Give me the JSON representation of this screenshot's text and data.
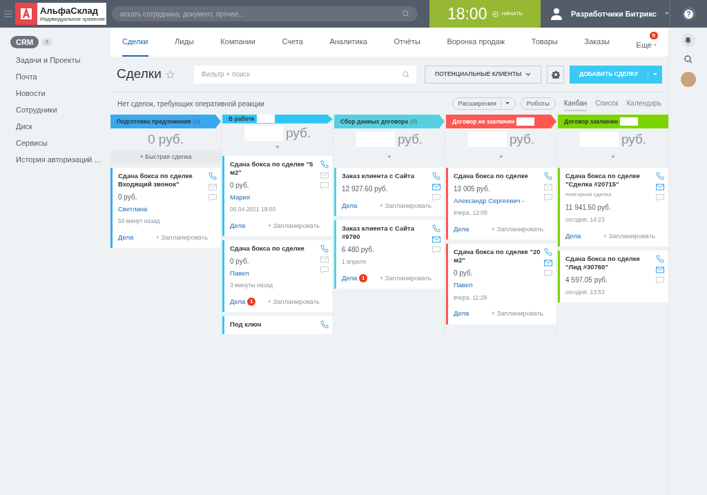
{
  "header": {
    "logo_title": "АльфаСклад",
    "logo_subtitle": "Индивидуальное хранение",
    "search_placeholder": "искать сотрудника, документ, прочее...",
    "clock": "18:00",
    "start": "НАЧАТЬ",
    "user": "Разработчики Битрикс",
    "help": "?"
  },
  "sidebar": {
    "items": [
      {
        "label": "CRM",
        "selected": true,
        "count": "5"
      },
      {
        "label": "Задачи и Проекты",
        "selected": false
      },
      {
        "label": "Почта",
        "selected": false
      },
      {
        "label": "Новости",
        "selected": false
      },
      {
        "label": "Сотрудники",
        "selected": false
      },
      {
        "label": "Диск",
        "selected": false
      },
      {
        "label": "Сервисы",
        "selected": false
      },
      {
        "label": "История авторизаций ...",
        "selected": false
      }
    ]
  },
  "tabs": [
    {
      "label": "Сделки",
      "selected": true
    },
    {
      "label": "Лиды",
      "selected": false
    },
    {
      "label": "Компании",
      "selected": false
    },
    {
      "label": "Счета",
      "selected": false
    },
    {
      "label": "Аналитика",
      "selected": false
    },
    {
      "label": "Отчёты",
      "selected": false
    },
    {
      "label": "Воронка продаж",
      "selected": false
    },
    {
      "label": "Товары",
      "selected": false
    },
    {
      "label": "Заказы",
      "selected": false
    },
    {
      "label": "Еще",
      "selected": false,
      "count": "5"
    }
  ],
  "toolbar": {
    "title": "Сделки",
    "filter_placeholder": "Фильтр + поиск",
    "category": "ПОТЕНЦИАЛЬНЫЕ КЛИЕНТЫ",
    "add": "ДОБАВИТЬ СДЕЛКУ"
  },
  "notice": "Нет сделок, требующих оперативной реакции",
  "actions": [
    "Расширения",
    "Роботы"
  ],
  "views": [
    {
      "label": "Канбан",
      "selected": true
    },
    {
      "label": "Список",
      "selected": false
    },
    {
      "label": "Календарь",
      "selected": false
    }
  ],
  "columns": [
    {
      "name": "Подготовка предложения",
      "count": "(1)",
      "color": "#39a8ef",
      "dark_text": true,
      "total": "0 руб.",
      "total_redacted": false,
      "add": "+ Быстрая сделка",
      "cards": [
        {
          "title": "Сдача бокса по сделке Входящий звонок\"",
          "price": "0 руб.",
          "contact": "Светлана",
          "date": "50 минут назад",
          "mail": false,
          "tasks": "Дела",
          "plan": "+ Запланировать"
        }
      ]
    },
    {
      "name": "В работе",
      "color": "#2fc6f6",
      "dark_text": true,
      "total": "руб.",
      "total_redacted": true,
      "add": "+",
      "cards": [
        {
          "title": "Сдача бокса по сделке \"5 м2\"",
          "price": "0 руб.",
          "contact": "Мария",
          "date": "06.04.2021 18:00",
          "mail": false,
          "tasks": "Дела",
          "plan": "+ Запланировать"
        },
        {
          "title": "Сдача бокса по сделке",
          "price": "0 руб.",
          "contact": "Павел",
          "date": "3 минуты назад",
          "mail": false,
          "tasks": "Дела",
          "badge": "1",
          "plan": "+ Запланировать"
        },
        {
          "title": "Под ключ"
        }
      ]
    },
    {
      "name": "Сбор данных договора",
      "count": "(2)",
      "color": "#55d0e0",
      "dark_text": true,
      "total": "руб.",
      "total_redacted": true,
      "add": "+",
      "cards": [
        {
          "title": "Заказ клиента с Сайта",
          "price": "12 927.60 руб.",
          "mail": true,
          "tasks": "Дела",
          "plan": "+ Запланировать"
        },
        {
          "title": "Заказ клиента с Сайта #9790",
          "price": "6 480 руб.",
          "date": "1 апреля",
          "mail": true,
          "tasks": "Дела",
          "badge": "1",
          "plan": "+ Запланировать"
        }
      ]
    },
    {
      "name": "Договор не заключен",
      "color": "#ff5752",
      "dark_text": false,
      "total": "руб.",
      "total_redacted": true,
      "add": "+",
      "cards": [
        {
          "title": "Сдача бокса по сделке",
          "price": "13 005 руб.",
          "contact": "Александр Сергеевич -",
          "date": "вчера, 12:09",
          "mail": false,
          "tasks": "Дела",
          "plan": "+ Запланировать"
        },
        {
          "title": "Сдача бокса по сделке \"20 м2\"",
          "price": "0 руб.",
          "contact": "Павел",
          "date": "вчера, 11:29",
          "mail": true,
          "tasks": "Дела",
          "plan": "+ Запланировать"
        }
      ]
    },
    {
      "name": "Договор заключен",
      "color": "#7bd500",
      "dark_text": true,
      "total": "руб.",
      "total_redacted": true,
      "add": "+",
      "cards": [
        {
          "title": "Сдача бокса по сделке \"Сделка #20715\"",
          "subtitle": "повторная сделка",
          "price": "11 941.50 руб.",
          "date": "сегодня, 14:23",
          "mail": true,
          "tasks": "Дела",
          "plan": "+ Запланировать"
        },
        {
          "title": "Сдача бокса по сделке \"Лид #30760\"",
          "price": "4 597.05 руб.",
          "date": "сегодня, 13:53",
          "mail": true
        }
      ]
    }
  ]
}
